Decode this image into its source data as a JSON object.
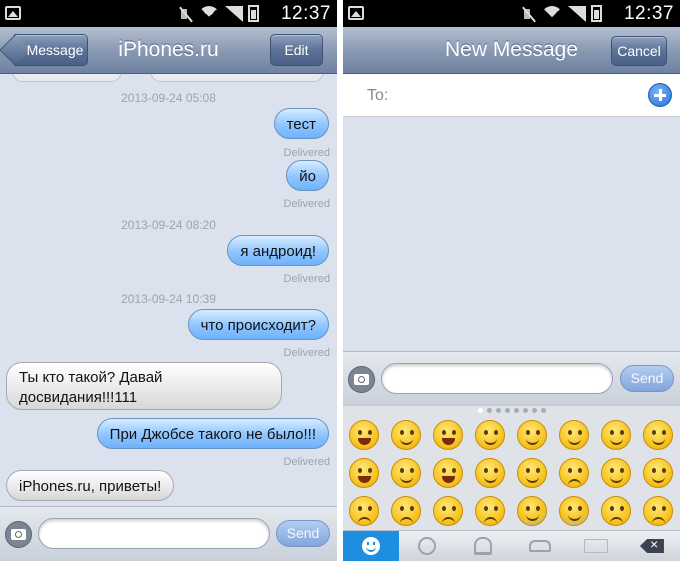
{
  "status_bar": {
    "time": "12:37"
  },
  "chat_screen": {
    "title": "iPhones.ru",
    "back_label": "Message",
    "edit_label": "Edit",
    "messages": [
      {
        "type": "stamp",
        "text": "2013-09-24 05:08"
      },
      {
        "type": "out",
        "text": "тест"
      },
      {
        "type": "delivered",
        "text": "Delivered"
      },
      {
        "type": "out",
        "text": "йо"
      },
      {
        "type": "delivered",
        "text": "Delivered"
      },
      {
        "type": "stamp",
        "text": "2013-09-24 08:20"
      },
      {
        "type": "out",
        "text": "я андроид!"
      },
      {
        "type": "delivered",
        "text": "Delivered"
      },
      {
        "type": "stamp",
        "text": "2013-09-24 10:39"
      },
      {
        "type": "out",
        "text": "что происходит?"
      },
      {
        "type": "delivered",
        "text": "Delivered"
      },
      {
        "type": "in",
        "text": "Ты кто такой? Давай досвидания!!!111"
      },
      {
        "type": "out",
        "text": "При Джобсе такого не было!!!"
      },
      {
        "type": "delivered",
        "text": "Delivered"
      },
      {
        "type": "in",
        "text": "iPhones.ru, приветы!"
      }
    ],
    "input_value": "",
    "send_label": "Send"
  },
  "new_message_screen": {
    "title": "New Message",
    "cancel_label": "Cancel",
    "to_label": "To:",
    "input_value": "",
    "send_label": "Send",
    "emoji_page_count": 8,
    "emoji_active_page": 1,
    "emoji_names": [
      [
        "grinning-face",
        "smiling-face",
        "smiley-face",
        "relaxed-face",
        "winking-face",
        "heart-eyes-face",
        "kissing-heart-face",
        "kissing-face"
      ],
      [
        "flushed-face",
        "relieved-face",
        "grimacing-face",
        "tongue-wink-face",
        "squinting-tongue-face",
        "unamused-face",
        "smirking-face",
        "sweat-face"
      ],
      [
        "pensive-face",
        "disappointed-face",
        "confounded-face",
        "crying-face",
        "cold-sweat-face",
        "fearful-face",
        "persevering-face",
        "crying-tear-face"
      ]
    ],
    "keyboard_tabs": [
      "smile-icon",
      "flower-icon",
      "bell-icon",
      "car-icon",
      "symbols-icon",
      "backspace-icon"
    ]
  }
}
